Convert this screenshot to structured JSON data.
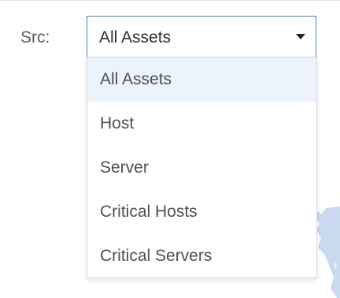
{
  "filter": {
    "label": "Src:",
    "selected_value": "All Assets",
    "options": [
      "All Assets",
      "Host",
      "Server",
      "Critical Hosts",
      "Critical Servers"
    ]
  },
  "colors": {
    "accent": "#3b7ee0",
    "selected_bg": "#edf3fb",
    "map_fill": "#c9d9f0"
  },
  "icons": {
    "dropdown_caret": "caret-down-icon"
  }
}
